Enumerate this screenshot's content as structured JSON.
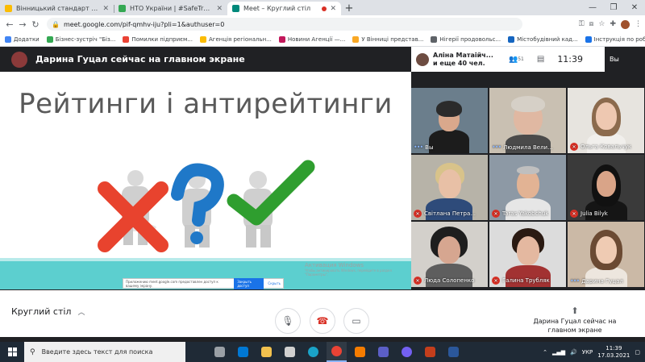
{
  "browser": {
    "tabs": [
      {
        "title": "Вінницький стандарт гостинності",
        "color": "#fbbc04"
      },
      {
        "title": "НТО України | #SafeTravels | Ком",
        "color": "#34a853"
      },
      {
        "title": "Meet – Круглий стіл",
        "color": "#00897b"
      }
    ],
    "new_tab": "+",
    "url": "meet.google.com/pif-qmhv-iju?pli=1&authuser=0",
    "bookmarks": [
      {
        "label": "Додатки",
        "color": "#4285f4"
      },
      {
        "label": "Бізнес-зустріч \"Біз...",
        "color": "#34a853"
      },
      {
        "label": "Помилки підприєм...",
        "color": "#ea4335"
      },
      {
        "label": "Агенція регіональн...",
        "color": "#fbbc04"
      },
      {
        "label": "Новини Агенції —...",
        "color": "#c2185b"
      },
      {
        "label": "У Вінниці представ...",
        "color": "#f9a825"
      },
      {
        "label": "Нігерії продовольс...",
        "color": "#5f6368"
      },
      {
        "label": "Містобудівний кад...",
        "color": "#1565c0"
      },
      {
        "label": "Інструкція по робо...",
        "color": "#1a73e8"
      }
    ]
  },
  "meet": {
    "presenter": "Дарина Гуцал сейчас на главном экране",
    "pinned": {
      "line1": "Аліна Матаійч...",
      "line2": "и еще 40 чел."
    },
    "people_count": "51",
    "clock": "11:39",
    "self_top": "Вы",
    "slide": {
      "title": "Рейтинги і антирейтинги",
      "notice_text": "Приложению meet.google.com предоставлен доступ к вашему экрану.",
      "notice_button": "Закрыть доступ",
      "notice_link": "Скрыть",
      "activation_title": "Активация Windows",
      "activation_sub": "Чтобы активировать Windows, перейдите в раздел \"Параметры\"."
    },
    "tiles": [
      {
        "name": "Вы",
        "muted": false,
        "speaking": true
      },
      {
        "name": "Людмила Вели...",
        "muted": false,
        "speaking": true
      },
      {
        "name": "Ольга Ковальчук",
        "muted": true,
        "speaking": false
      },
      {
        "name": "Світлана Петра...",
        "muted": true,
        "speaking": false
      },
      {
        "name": "Taras Yakobchuk",
        "muted": true,
        "speaking": false
      },
      {
        "name": "Julia Bilyk",
        "muted": true,
        "speaking": false
      },
      {
        "name": "Люда Солопенко",
        "muted": true,
        "speaking": false
      },
      {
        "name": "Галина Трубляк",
        "muted": true,
        "speaking": false
      },
      {
        "name": "Дарина Гуцал",
        "muted": false,
        "speaking": true
      }
    ],
    "meeting_name": "Круглий стіл",
    "present_now": "Дарина Гуцал сейчас на главном экране"
  },
  "taskbar": {
    "search_placeholder": "Введите здесь текст для поиска",
    "lang": "УКР",
    "time": "11:39",
    "date": "17.03.2021"
  }
}
